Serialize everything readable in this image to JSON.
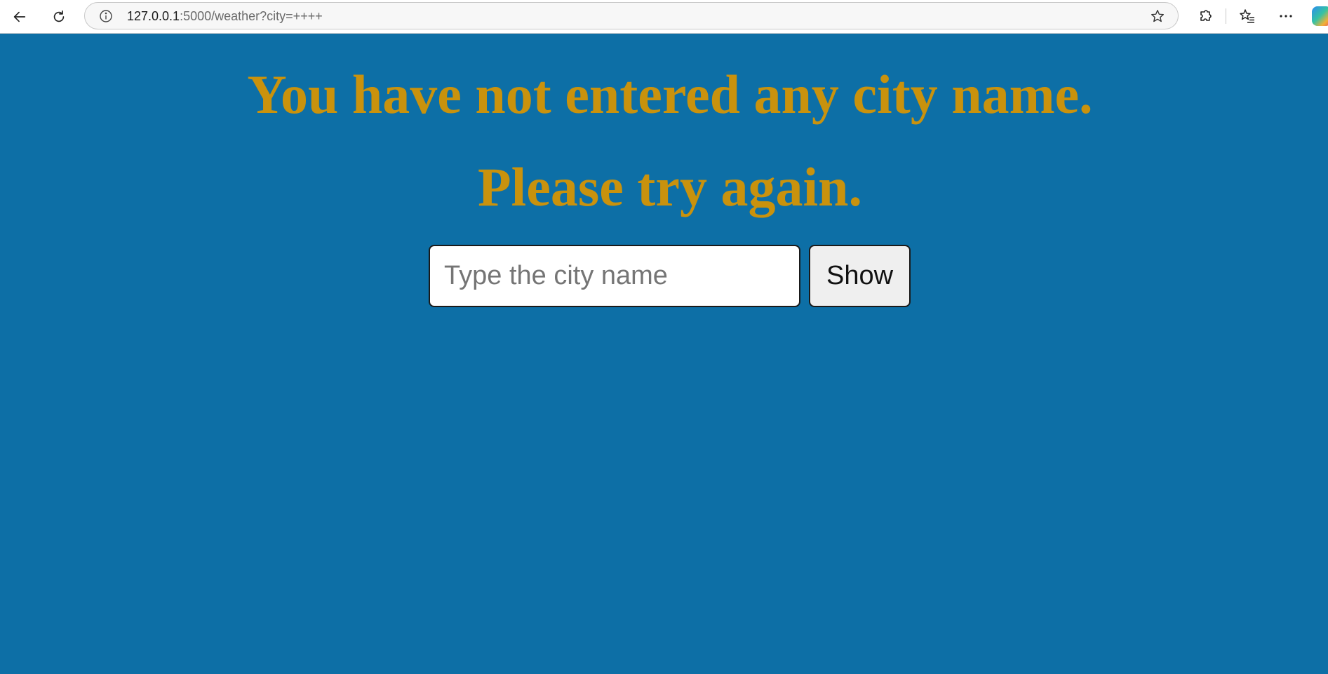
{
  "browser": {
    "url_host": "127.0.0.1",
    "url_rest": ":5000/weather?city=++++",
    "icons": [
      "back-arrow-icon",
      "reload-icon",
      "site-info-icon",
      "favorite-star-icon",
      "extensions-icon",
      "favorites-icon",
      "more-options-icon",
      "copilot-icon"
    ]
  },
  "page": {
    "heading_line1": "You have not entered any city name.",
    "heading_line2": "Please try again.",
    "city_input": {
      "placeholder": "Type the city name",
      "value": ""
    },
    "show_button_label": "Show"
  },
  "colors": {
    "page_background": "#0d6fa6",
    "heading": "#c9920d"
  }
}
